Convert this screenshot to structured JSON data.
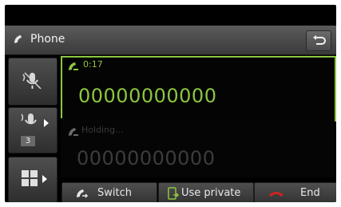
{
  "header": {
    "title": "Phone"
  },
  "active_call": {
    "duration": "0:17",
    "number": "00000000000"
  },
  "held_call": {
    "status": "Holding...",
    "number": "00000000000"
  },
  "side_buttons": {
    "conference_count": "3"
  },
  "actions": {
    "switch_label": "Switch",
    "private_label": "Use private",
    "end_label": "End"
  },
  "colors": {
    "accent": "#8cc63f",
    "end_red": "#d62020"
  }
}
